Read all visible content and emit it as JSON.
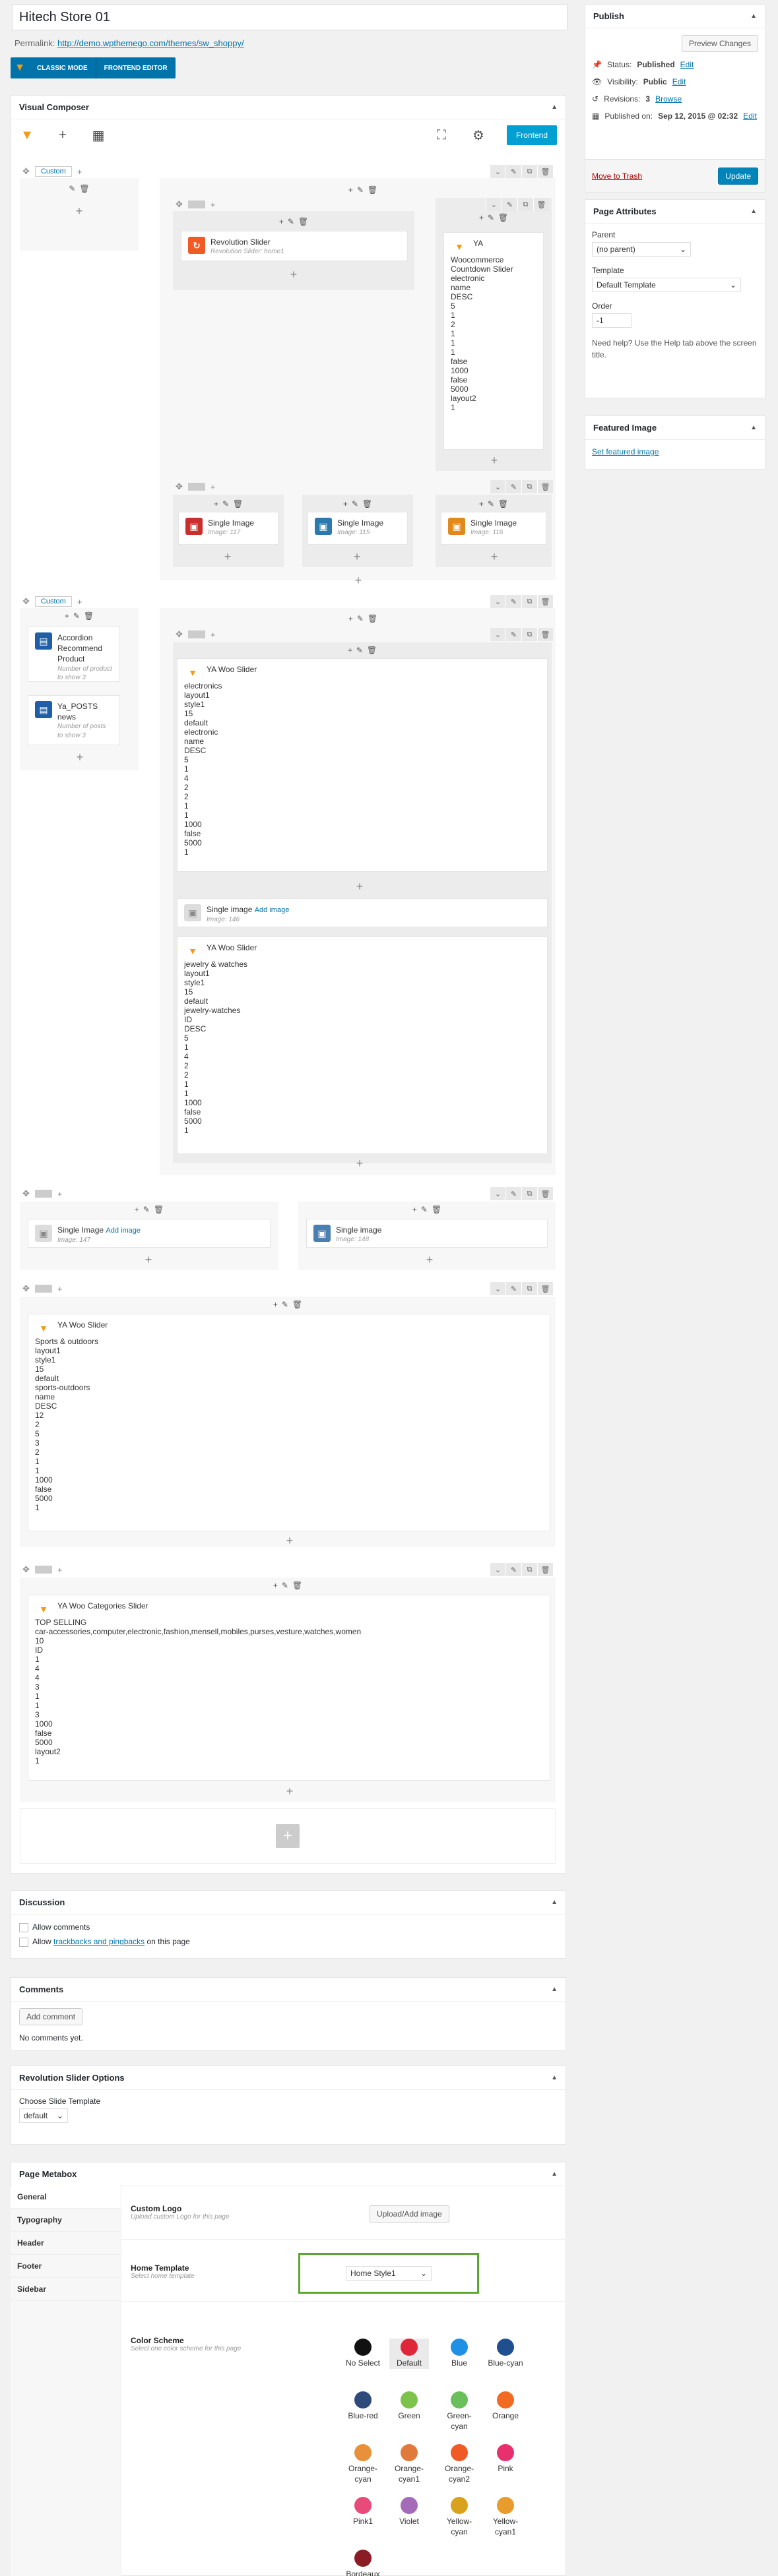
{
  "post": {
    "title": "Hitech Store 01",
    "permalink_label": "Permalink:",
    "permalink_url": "http://demo.wpthemego.com/themes/sw_shoppy/",
    "classic_mode": "CLASSIC MODE",
    "frontend_editor": "FRONTEND EDITOR"
  },
  "vc": {
    "title": "Visual Composer",
    "frontend_btn": "Frontend",
    "rows": {
      "r1": {
        "col1_tab": "Custom",
        "rev_title": "Revolution Slider",
        "rev_sub": "Revolution Slider: home1",
        "ya_title": "YA",
        "ya_lines": [
          "Woocommerce",
          "Countdown Slider",
          "electronic",
          "name",
          "DESC",
          "5",
          "1",
          "2",
          "1",
          "1",
          "1",
          "false",
          "1000",
          "false",
          "5000",
          "layout2",
          "1"
        ],
        "img1_title": "Single Image",
        "img1_sub": "Image: 117",
        "img2_title": "Single Image",
        "img2_sub": "Image: 115",
        "img3_title": "Single Image",
        "img3_sub": "Image: 116"
      },
      "r2": {
        "col1_tab": "Custom",
        "acc_title": "Accordion Recommend Product",
        "acc_sub": "Number of product to show 3",
        "posts_title": "Ya_POSTS",
        "posts_sub1": "news",
        "posts_sub2": "Number of posts to show 3",
        "slider1_title": "YA Woo Slider",
        "slider1_lines": [
          "electronics",
          "layout1",
          "style1",
          "15",
          "default",
          "electronic",
          "name",
          "DESC",
          "5",
          "1",
          "4",
          "2",
          "2",
          "1",
          "1",
          "1000",
          "false",
          "5000",
          "1"
        ],
        "img_title": "Single image",
        "img_add": "Add image",
        "img_sub": "Image: 146",
        "slider2_title": "YA Woo Slider",
        "slider2_lines": [
          "jewelry & watches",
          "layout1",
          "style1",
          "15",
          "default",
          "jewelry-watches",
          "ID",
          "DESC",
          "5",
          "1",
          "4",
          "2",
          "2",
          "1",
          "1",
          "1000",
          "false",
          "5000",
          "1"
        ]
      },
      "r3": {
        "img1_title": "Single Image",
        "img1_add": "Add image",
        "img1_sub": "Image: 147",
        "img2_title": "Single image",
        "img2_sub": "Image: 148"
      },
      "r4": {
        "title": "YA Woo Slider",
        "lines": [
          "Sports & outdoors",
          "layout1",
          "style1",
          "15",
          "default",
          "sports-outdoors",
          "name",
          "DESC",
          "12",
          "2",
          "5",
          "3",
          "2",
          "1",
          "1",
          "1000",
          "false",
          "5000",
          "1"
        ]
      },
      "r5": {
        "title": "YA Woo Categories Slider",
        "lines": [
          "TOP SELLING",
          "car-accessories,computer,electronic,fashion,mensell,mobiles,purses,vesture,watches,women",
          "10",
          "ID",
          "1",
          "4",
          "4",
          "3",
          "1",
          "1",
          "3",
          "1000",
          "false",
          "5000",
          "layout2",
          "1"
        ]
      }
    }
  },
  "discussion": {
    "title": "Discussion",
    "allow_comments": "Allow comments",
    "allow_pre": "Allow",
    "trackbacks": "trackbacks and pingbacks",
    "allow_post": "on this page"
  },
  "comments": {
    "title": "Comments",
    "add_btn": "Add comment",
    "empty": "No comments yet."
  },
  "revslider": {
    "title": "Revolution Slider Options",
    "label": "Choose Slide Template",
    "value": "default"
  },
  "metabox": {
    "title": "Page Metabox",
    "tabs": [
      "General",
      "Typography",
      "Header",
      "Footer",
      "Sidebar"
    ],
    "logo_label": "Custom Logo",
    "logo_desc": "Upload custom Logo for this page",
    "logo_btn": "Upload/Add image",
    "home_label": "Home Template",
    "home_desc": "Select home template",
    "home_value": "Home Style1",
    "color_label": "Color Scheme",
    "color_desc": "Select one color scheme for this page",
    "colors": [
      {
        "name": "No Select",
        "hex": "#111111"
      },
      {
        "name": "Default",
        "hex": "#e0263a"
      },
      {
        "name": "Blue",
        "hex": "#1e90e6"
      },
      {
        "name": "Blue-cyan",
        "hex": "#1f4f8f"
      },
      {
        "name": "Blue-red",
        "hex": "#2e4a7a"
      },
      {
        "name": "Green",
        "hex": "#7dc24b"
      },
      {
        "name": "Green-cyan",
        "hex": "#6bbf5a"
      },
      {
        "name": "Orange",
        "hex": "#f26b22"
      },
      {
        "name": "Orange-cyan",
        "hex": "#e8903a"
      },
      {
        "name": "Orange-cyan1",
        "hex": "#e07a3c"
      },
      {
        "name": "Orange-cyan2",
        "hex": "#f05a24"
      },
      {
        "name": "Pink",
        "hex": "#e8306e"
      },
      {
        "name": "Pink1",
        "hex": "#e84a7a"
      },
      {
        "name": "Violet",
        "hex": "#a36bb8"
      },
      {
        "name": "Yellow-cyan",
        "hex": "#d9a21c"
      },
      {
        "name": "Yellow-cyan1",
        "hex": "#e89c2c"
      },
      {
        "name": "Bordeaux",
        "hex": "#8b1c24"
      }
    ]
  },
  "publish": {
    "title": "Publish",
    "preview_btn": "Preview Changes",
    "status_label": "Status:",
    "status_value": "Published",
    "status_edit": "Edit",
    "visibility_label": "Visibility:",
    "visibility_value": "Public",
    "visibility_edit": "Edit",
    "revisions_label": "Revisions:",
    "revisions_value": "3",
    "revisions_browse": "Browse",
    "published_label": "Published on:",
    "published_value": "Sep 12, 2015 @ 02:32",
    "published_edit": "Edit",
    "trash": "Move to Trash",
    "update_btn": "Update"
  },
  "page_attributes": {
    "title": "Page Attributes",
    "parent_label": "Parent",
    "parent_value": "(no parent)",
    "template_label": "Template",
    "template_value": "Default Template",
    "order_label": "Order",
    "order_value": "-1",
    "help": "Need help? Use the Help tab above the screen title."
  },
  "featured": {
    "title": "Featured Image",
    "link": "Set featured image"
  }
}
